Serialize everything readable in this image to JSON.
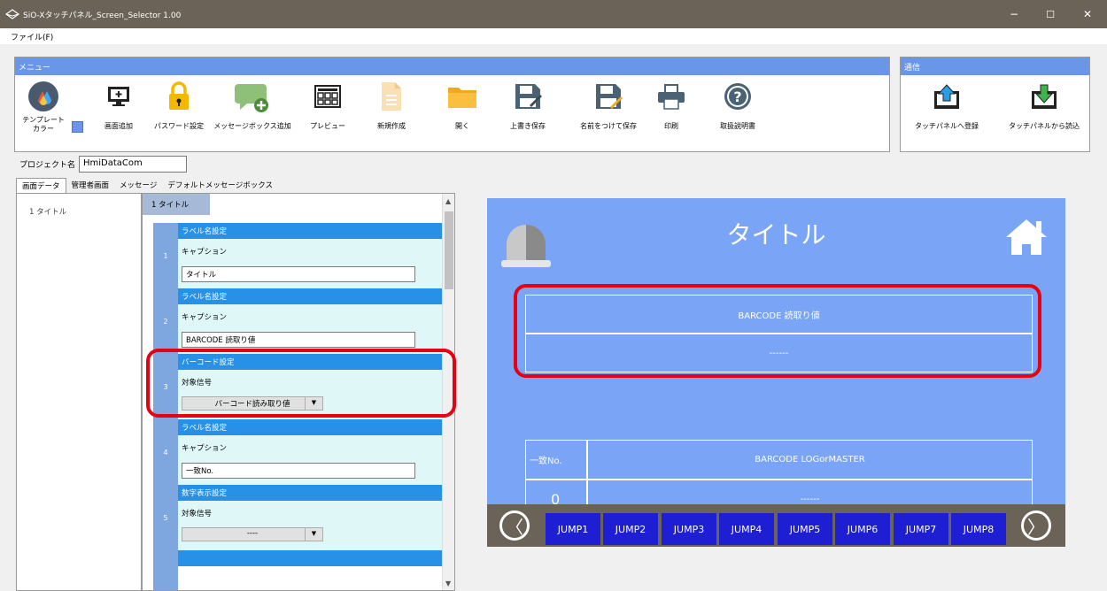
{
  "window": {
    "title": "SiO-Xタッチパネル_Screen_Selector 1.00",
    "minimize": "−",
    "maximize": "☐",
    "close": "✕"
  },
  "menubar": {
    "file": "ファイル(F)"
  },
  "menu_panel": {
    "header": "メニュー",
    "tools": [
      {
        "label": "テンプレート\nカラー",
        "icon": "template-color-icon"
      },
      {
        "label": "画面追加",
        "icon": "add-screen-icon"
      },
      {
        "label": "パスワード設定",
        "icon": "lock-icon"
      },
      {
        "label": "メッセージボックス追加",
        "icon": "add-message-icon"
      },
      {
        "label": "プレビュー",
        "icon": "preview-icon"
      },
      {
        "label": "新規作成",
        "icon": "new-file-icon"
      },
      {
        "label": "開く",
        "icon": "folder-icon"
      },
      {
        "label": "上書き保存",
        "icon": "save-icon"
      },
      {
        "label": "名前をつけて保存",
        "icon": "save-as-icon"
      },
      {
        "label": "印刷",
        "icon": "printer-icon"
      },
      {
        "label": "取扱説明書",
        "icon": "help-icon"
      }
    ]
  },
  "comm_panel": {
    "header": "通信",
    "tools": [
      {
        "label": "タッチパネルへ登録",
        "icon": "upload-icon"
      },
      {
        "label": "タッチパネルから読込",
        "icon": "download-icon"
      }
    ]
  },
  "project": {
    "label": "プロジェクト名",
    "value": "HmiDataCom"
  },
  "tabs": [
    "画面データ",
    "管理者画面",
    "メッセージ",
    "デフォルトメッセージボックス"
  ],
  "screen_list": [
    "1 タイトル"
  ],
  "editor": {
    "tab": "1 タイトル",
    "blocks": [
      {
        "num": "1",
        "header": "ラベル名設定",
        "label": "キャプション",
        "value": "タイトル",
        "kind": "input"
      },
      {
        "num": "2",
        "header": "ラベル名設定",
        "label": "キャプション",
        "value": "BARCODE 読取り値",
        "kind": "input"
      },
      {
        "num": "3",
        "header": "バーコード設定",
        "label": "対象信号",
        "value": "バーコード読み取り値",
        "kind": "select"
      },
      {
        "num": "4",
        "header": "ラベル名設定",
        "label": "キャプション",
        "value": "一致No.",
        "kind": "input"
      },
      {
        "num": "5",
        "header": "数字表示設定",
        "label": "対象信号",
        "value": "----",
        "kind": "select"
      }
    ],
    "dropdown_glyph": "▼",
    "scroll_up": "▲",
    "scroll_down": "▼"
  },
  "preview": {
    "title": "タイトル",
    "barcode_label": "BARCODE 読取り値",
    "barcode_value": "------",
    "match_label": "一致No.",
    "match_value": "0",
    "log_label": "BARCODE LOGorMASTER",
    "log_value": "------",
    "jumps": [
      "JUMP1",
      "JUMP2",
      "JUMP3",
      "JUMP4",
      "JUMP5",
      "JUMP6",
      "JUMP7",
      "JUMP8"
    ],
    "prev": "〈",
    "next": "〉"
  },
  "colors": {
    "accent": "#6a96e8",
    "preview_bg": "#7aa4f5",
    "jump_btn": "#1e1ed2",
    "highlight": "#e60012",
    "titlebar": "#6b6357"
  }
}
